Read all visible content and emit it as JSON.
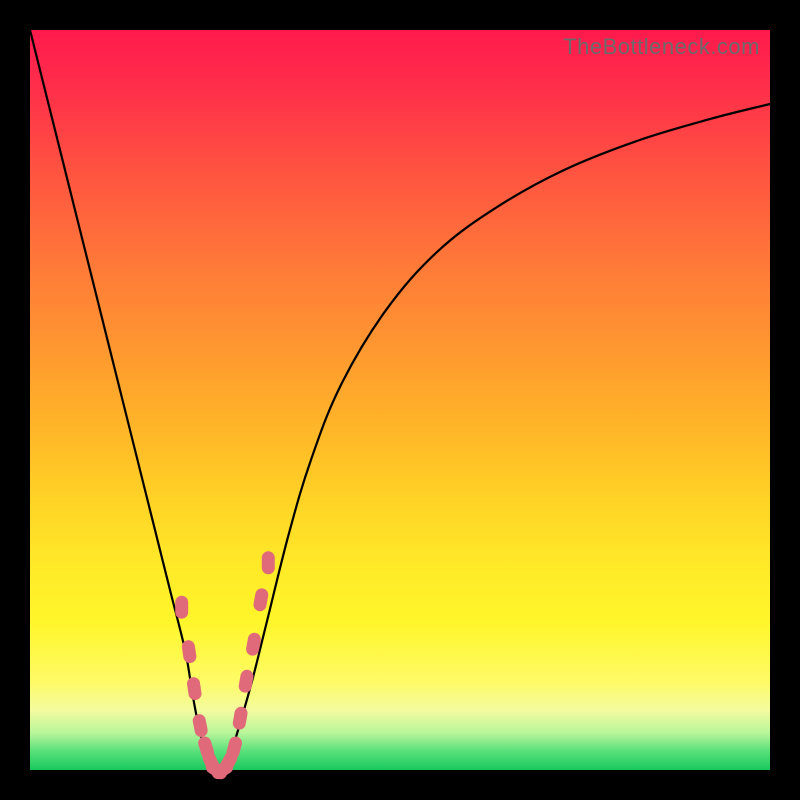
{
  "domain": "Chart",
  "source_label": "TheBottleneck.com",
  "colors": {
    "frame": "#000000",
    "gradient_top": "#ff1a4d",
    "gradient_bottom": "#18c95e",
    "curve": "#000000",
    "marker": "#e06a7a"
  },
  "chart_data": {
    "type": "line",
    "title": "",
    "xlabel": "",
    "ylabel": "",
    "xlim": [
      0,
      100
    ],
    "ylim": [
      0,
      100
    ],
    "x": [
      0,
      3,
      6,
      9,
      12,
      15,
      17,
      19,
      21,
      22,
      23,
      24,
      25,
      26,
      27,
      28,
      30,
      32,
      35,
      38,
      42,
      48,
      55,
      63,
      72,
      82,
      92,
      100
    ],
    "values": [
      100,
      88,
      76,
      64,
      52,
      40,
      32,
      24,
      16,
      10,
      5,
      2,
      0,
      0,
      2,
      5,
      12,
      20,
      32,
      42,
      52,
      62,
      70,
      76,
      81,
      85,
      88,
      90
    ],
    "markers": {
      "x": [
        20.5,
        21.5,
        22.2,
        23.0,
        23.8,
        24.5,
        25.2,
        26.0,
        26.8,
        27.6,
        28.4,
        29.2,
        30.2,
        31.2,
        32.2
      ],
      "values": [
        22,
        16,
        11,
        6,
        3,
        1,
        0,
        0,
        1,
        3,
        7,
        12,
        17,
        23,
        28
      ],
      "color": "#e06a7a"
    },
    "notes": "V-shaped bottleneck curve; minimum ≈ x 25, y 0; background is heat gradient red→green; no axis ticks or labels visible."
  }
}
